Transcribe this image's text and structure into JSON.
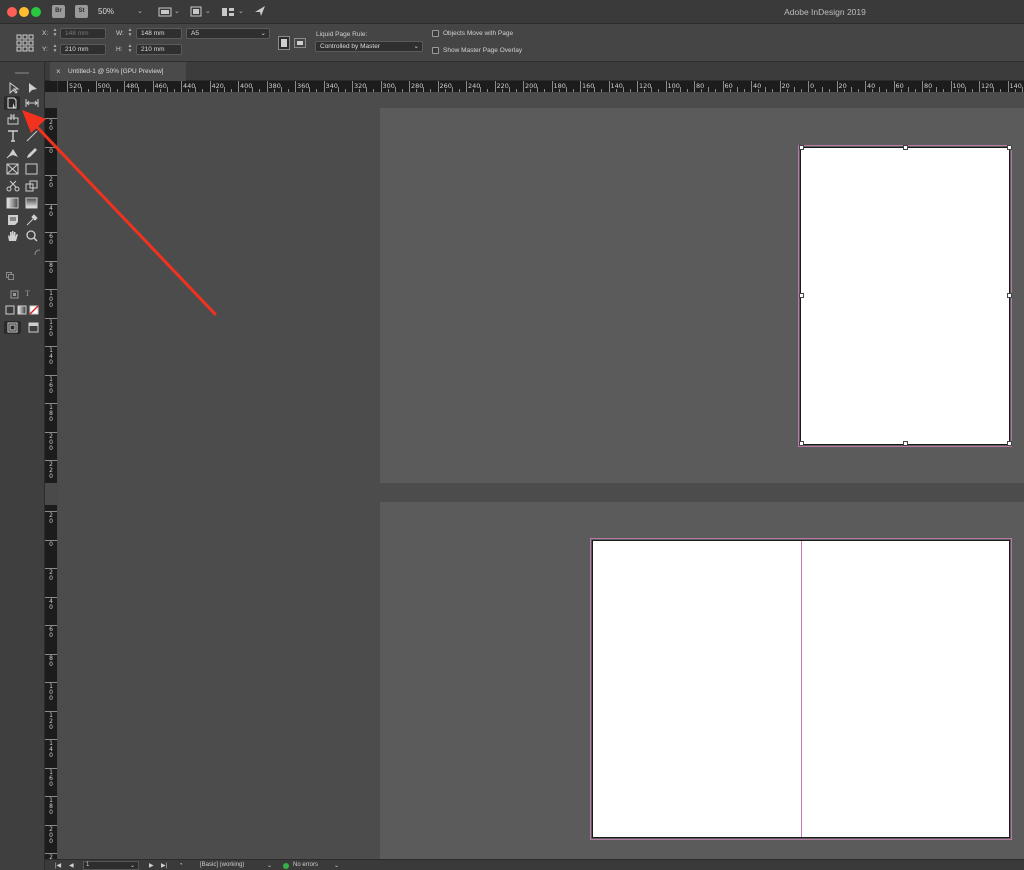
{
  "titlebar": {
    "app_title": "Adobe InDesign 2019",
    "bridge_badge": "Br",
    "stock_badge": "St",
    "zoom_value": "50%",
    "icons": [
      "screen-mode-icon",
      "view-options-icon",
      "arrange-documents-icon",
      "publish-online-icon"
    ]
  },
  "controlbar": {
    "x_label": "X:",
    "x_value": "148 mm",
    "y_label": "Y:",
    "y_value": "210 mm",
    "w_label": "W:",
    "w_value": "148 mm",
    "h_label": "H:",
    "h_value": "210 mm",
    "page_size": "A5",
    "liquid_label": "Liquid Page Rule:",
    "liquid_value": "Controlled by Master",
    "objects_move_label": "Objects Move with Page",
    "objects_move_checked": false,
    "master_overlay_label": "Show Master Page Overlay",
    "master_overlay_checked": false
  },
  "tabs": {
    "document_tab": "Untitled-1 @ 50% [GPU Preview]"
  },
  "rulers": {
    "horizontal": [
      "520",
      "500",
      "480",
      "460",
      "440",
      "420",
      "400",
      "380",
      "360",
      "340",
      "320",
      "300",
      "280",
      "260",
      "240",
      "220",
      "200",
      "180",
      "160",
      "140",
      "120",
      "100",
      "80",
      "60",
      "40",
      "20",
      "0",
      "20",
      "40",
      "60",
      "80",
      "100",
      "120",
      "140"
    ],
    "vertical_top": [
      "2\n0",
      "0",
      "2\n0",
      "4\n0",
      "6\n0",
      "8\n0",
      "1\n0\n0",
      "1\n2\n0",
      "1\n4\n0",
      "1\n6\n0",
      "1\n8\n0",
      "2\n0\n0",
      "2\n2\n0"
    ],
    "vertical_bottom": [
      "2\n0",
      "0",
      "2\n0",
      "4\n0",
      "6\n0",
      "8\n0",
      "1\n0\n0",
      "1\n2\n0",
      "1\n4\n0",
      "1\n6\n0",
      "1\n8\n0",
      "2\n0\n0",
      "2\n2\n0"
    ]
  },
  "toolbox": {
    "selected_tool": "page-tool",
    "tools": [
      "selection-tool",
      "direct-selection-tool",
      "page-tool",
      "gap-tool",
      "content-collector-tool",
      "type-tool",
      "line-tool",
      "pen-tool",
      "pencil-tool",
      "rectangle-frame-tool",
      "rectangle-tool",
      "scissors-tool",
      "free-transform-tool",
      "gradient-swatch-tool",
      "gradient-feather-tool",
      "note-tool",
      "eyedropper-tool",
      "hand-tool",
      "zoom-tool"
    ]
  },
  "statusbar": {
    "page_number": "1",
    "preflight_profile": "[Basic] (working)",
    "preflight_status": "No errors"
  },
  "colors": {
    "annotation_arrow": "#f2321e",
    "page_margin": "#c678b4",
    "canvas": "#4c4c4c",
    "pasteboard": "#5b5b5b"
  }
}
